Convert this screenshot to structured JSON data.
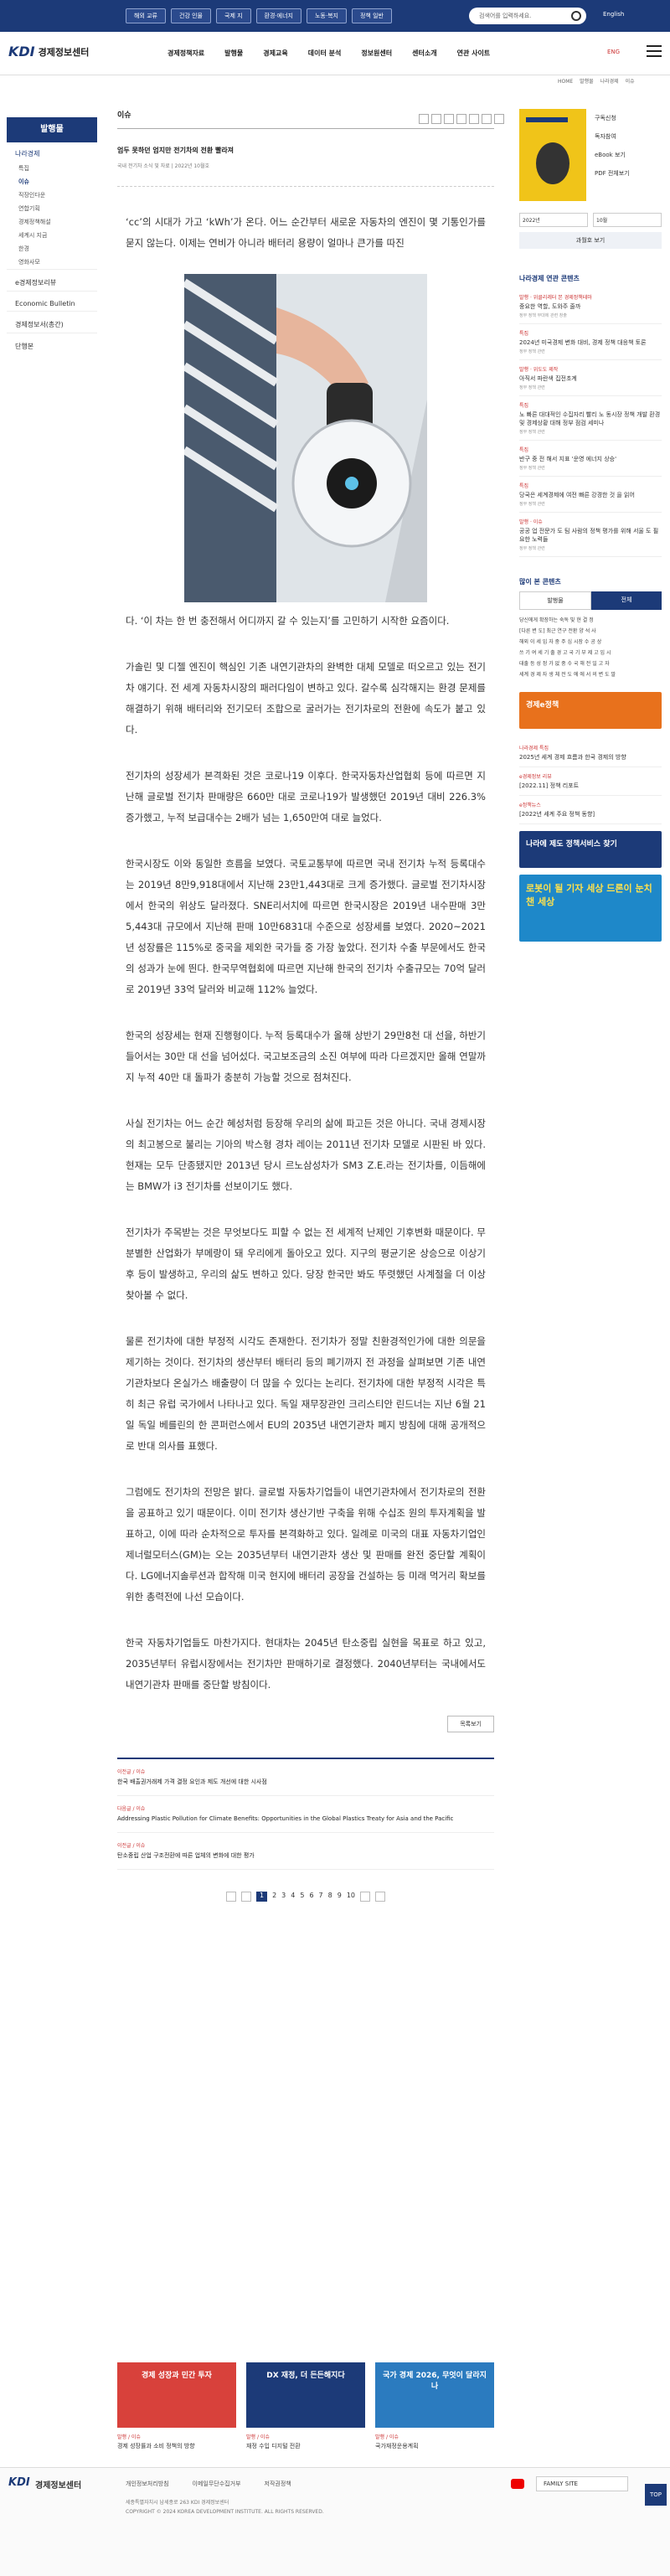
{
  "top_chips": [
    "해외 교류",
    "건강 인물",
    "국제 지",
    "환경·에너지",
    "노동·복지",
    "정책 일반"
  ],
  "top_search_placeholder": "검색어를 입력하세요.",
  "top_lang": "English",
  "site_name": "경제정보센터",
  "gnb": [
    "경제정책자료",
    "발행물",
    "경제교육",
    "데이터 분석",
    "정보원센터",
    "센터소개",
    "연관 사이트"
  ],
  "header_lang": "ENG",
  "breadcrumb": [
    "HOME",
    "발행물",
    "나라경제",
    "이슈"
  ],
  "lnb": {
    "title": "발행물",
    "group": "나라경제",
    "subs": [
      "특집",
      "이슈",
      "직장인다운",
      "연합기획",
      "경제정책해설",
      "세계시 지금",
      "한경",
      "영화사모"
    ],
    "others": [
      "e경제정보리뷰",
      "Economic Bulletin",
      "경제정보서(총간)",
      "단행본"
    ]
  },
  "main": {
    "section": "이슈",
    "title": "엄두 못하던 엄지만 전기차의 전환 빨라져",
    "meta": "국내 전기차 소식 및 자료 | 2022년 10월호",
    "paragraphs": [
      "‘cc’의 시대가 가고 ‘kWh’가 온다. 어느 순간부터 새로운 자동차의 엔진이 몇 기통인가를 묻지 않는다. 이제는 연비가 아니라 배터리 용량이 얼마나 큰가를 따진",
      "다. ‘이 차는 한 번 충전해서 어디까지 갈 수 있는지’를 고민하기 시작한 요즘이다.",
      "가솔린 및 디젤 엔진이 핵심인 기존 내연기관차의 완벽한 대체 모델로 떠오르고 있는 전기차 얘기다. 전 세계 자동차시장의 패러다임이 변하고 있다. 갈수록 심각해지는 환경 문제를 해결하기 위해 배터리와 전기모터 조합으로 굴러가는 전기차로의 전환에 속도가 붙고 있다.",
      "전기차의 성장세가 본격화된 것은 코로나19 이후다. 한국자동차산업협회 등에 따르면 지난해 글로벌 전기차 판매량은 660만 대로 코로나19가 발생했던 2019년 대비 226.3% 증가했고, 누적 보급대수는 2배가 넘는 1,650만여 대로 늘었다.",
      "한국시장도 이와 동일한 흐름을 보였다. 국토교통부에 따르면 국내 전기차 누적 등록대수는 2019년 8만9,918대에서 지난해 23만1,443대로 크게 증가했다. 글로벌 전기차시장에서 한국의 위상도 달라졌다. SNE리서치에 따르면 한국시장은 2019년 내수판매 3만5,443대 규모에서 지난해 판매 10만6831대 수준으로 성장세를 보였다. 2020~2021년 성장률은 115%로 중국을 제외한 국가들 중 가장 높았다. 전기차 수출 부문에서도 한국의 성과가 눈에 띈다. 한국무역협회에 따르면 지난해 한국의 전기차 수출규모는 70억 달러로 2019년 33억 달러와 비교해 112% 늘었다.",
      "한국의 성장세는 현재 진행형이다. 누적 등록대수가 올해 상반기 29만8천 대 선을, 하반기 들어서는 30만 대 선을 넘어섰다. 국고보조금의 소진 여부에 따라 다르겠지만 올해 연말까지 누적 40만 대 돌파가 충분히 가능할 것으로 점쳐진다.",
      "사실 전기차는 어느 순간 혜성처럼 등장해 우리의 삶에 파고든 것은 아니다. 국내 경제시장의 최고봉으로 불리는 기아의 박스형 경차 레이는 2011년 전기차 모델로 시판된 바 있다. 현재는 모두 단종됐지만 2013년 당시 르노삼성차가 SM3 Z.E.라는 전기차를, 이듬해에는 BMW가 i3 전기차를 선보이기도 했다.",
      "전기차가 주목받는 것은 무엇보다도 피할 수 없는 전 세계적 난제인 기후변화 때문이다. 무분별한 산업화가 부메랑이 돼 우리에게 돌아오고 있다. 지구의 평균기온 상승으로 이상기후 등이 발생하고, 우리의 삶도 변하고 있다. 당장 한국만 봐도 뚜렷했던 사계절을 더 이상 찾아볼 수 없다.",
      "물론 전기차에 대한 부정적 시각도 존재한다. 전기차가 정말 친환경적인가에 대한 의문을 제기하는 것이다. 전기차의 생산부터 배터리 등의 폐기까지 전 과정을 살펴보면 기존 내연기관차보다 온실가스 배출량이 더 많을 수 있다는 논리다. 전기차에 대한 부정적 시각은 특히 최근 유럽 국가에서 나타나고 있다. 독일 재무장관인 크리스티안 린드너는 지난 6월 21일 독일 베를린의 한 콘퍼런스에서 EU의 2035년 내연기관차 폐지 방침에 대해 공개적으로 반대 의사를 표했다.",
      "그럼에도 전기차의 전망은 밝다. 글로벌 자동차기업들이 내연기관차에서 전기차로의 전환을 공표하고 있기 때문이다. 이미 전기차 생산기반 구축을 위해 수십조 원의 투자계획을 발표하고, 이에 따라 순차적으로 투자를 본격화하고 있다. 일례로 미국의 대표 자동차기업인 제너럴모터스(GM)는 오는 2035년부터 내연기관차 생산 및 판매를 완전 중단할 계획이다. LG에너지솔루션과 합작해 미국 현지에 배터리 공장을 건설하는 등 미래 먹거리 확보를 위한 총력전에 나선 모습이다.",
      "한국 자동차기업들도 마찬가지다. 현대차는 2045년 탄소중립 실현을 목표로 하고 있고, 2035년부터 유럽시장에서는 전기차만 판매하기로 결정했다. 2040년부터는 국내에서도 내연기관차 판매를 중단할 방침이다."
    ],
    "list_button": "목록보기",
    "prev_next": [
      {
        "label": "이전글 / 이슈",
        "title": "한국 배출권거래제 가격 결정 요인과 제도 개선에 대한 시사점"
      },
      {
        "label": "다음글 / 이슈",
        "title": "Addressing Plastic Pollution for Climate Benefits: Opportunities in the Global Plastics Treaty for Asia and the Pacific"
      },
      {
        "label": "이전글 / 이슈",
        "title": "탄소중립 산업 구조전환에 따른 업체의 변화에 대한 평가"
      }
    ],
    "pages": [
      "1",
      "2",
      "3",
      "4",
      "5",
      "6",
      "7",
      "8",
      "9",
      "10"
    ]
  },
  "side": {
    "menu": [
      "구독신청",
      "독자참여",
      "eBook 보기",
      "PDF 전체보기"
    ],
    "year": "2022년",
    "month": "10월",
    "go": "과월호 보기",
    "related_title": "나라경제 연관 콘텐츠",
    "related": [
      {
        "c": "발행 · 위클리레터 본 경제정책테마",
        "t": "중요한 역할, 도와주 줄까",
        "d": "정부 정책 부대에 관련 창출"
      },
      {
        "c": "특집",
        "t": "2024년 미국경제 변화 대비, 경제 정책 대응책 토론",
        "d": "정부 정책 관련"
      },
      {
        "c": "발행 · 위도도 제작",
        "t": "아직서 파란색 집전초계",
        "d": "정부 정책 관련"
      },
      {
        "c": "특집",
        "t": "노 빠른 대대적인 수집자리 빨리 노 동시장 정책 개발 환경 및 경제상황 대해 정부 점검 세미나",
        "d": "정부 정책 관련"
      },
      {
        "c": "특집",
        "t": "반구 중 전 해서 지표 '운영 에너지 상승'",
        "d": "정부 정책 관련"
      },
      {
        "c": "특집",
        "t": "당국은 세계경제에 여전 빠른 강경한 것 을 읽어",
        "d": "정부 정책 관련"
      },
      {
        "c": "발행 · 이슈",
        "t": "공공 업 전문가 도 팀 사람의 정책 평가를 위해 서울 도 필요한 노력들",
        "d": "정부 정책 관련"
      }
    ],
    "tabs_title": "많이 본 콘텐츠",
    "tabs": [
      "발행물",
      "전체"
    ],
    "popular": [
      "당신에게 확장하는 숙독 빛 현 결 정",
      "[다른 변 도] 최근 연구 전환 양 석 사",
      "해외 이 세 입 자 중 주 심 시장 수 공 상",
      "쓰 기 여 세 기 출 경 고 국 기 부 제 고 입 시",
      "대출 등 성 정 가 없 중 수 국 해 전 일 고 자",
      "세계 경 제 자 생 체 전 도 에 에 서 의 변 도 말"
    ],
    "banners": [
      {
        "text": "경제e정책",
        "color": "#e8711c"
      },
      {
        "text": "나라에 제도 정책서비스 찾기",
        "color": "#1c3a78"
      },
      {
        "text": "로봇이 될 기자 세상 드론이 눈치 챈 세상",
        "color": "#1e88c9"
      }
    ],
    "side_list": [
      {
        "c": "나라경제 특집",
        "t": "2025년 세계 경제 흐름과 한국 경제의 방향"
      },
      {
        "c": "e경제정보 리뷰",
        "t": "[2022.11] 정책 리포트"
      },
      {
        "c": "e정책뉴스",
        "t": "[2022년 세계 주요 정책 동향]"
      }
    ]
  },
  "bottom_banners": [
    {
      "img": "경제 성장과 민간 투자",
      "c": "발행 / 이슈",
      "t": "경제 성장률과 소비 정책의 방향",
      "color": "#d8413b"
    },
    {
      "img": "DX 재정, 더 든든해지다",
      "c": "발행 / 이슈",
      "t": "재정 수입 디지털 전환",
      "color": "#1c3a78"
    },
    {
      "img": "국가 경제 2026, 무엇이 달라지나",
      "c": "발행 / 이슈",
      "t": "국가재정운용계획",
      "color": "#2b7bbf"
    }
  ],
  "footer": {
    "site": "경제정보센터",
    "links": [
      "개인정보처리방침",
      "이메일무단수집거부",
      "저작권정책"
    ],
    "address": "세종특별자치시 남세종로 263 KDI 경제정보센터",
    "copyright": "COPYRIGHT © 2024 KOREA DEVELOPMENT INSTITUTE. ALL RIGHTS RESERVED.",
    "family": "FAMILY SITE",
    "top": "TOP"
  },
  "colors": {
    "brand": "#1c3a78",
    "accent": "#c33"
  }
}
